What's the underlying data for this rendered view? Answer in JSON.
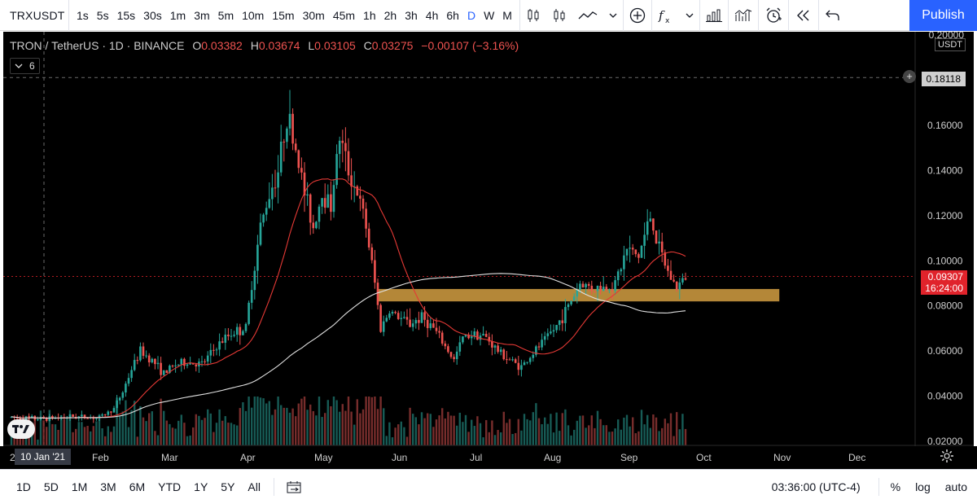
{
  "toolbar": {
    "symbol": "TRXUSDT",
    "intervals": [
      {
        "label": "1s",
        "active": false
      },
      {
        "label": "5s",
        "active": false
      },
      {
        "label": "15s",
        "active": false
      },
      {
        "label": "30s",
        "active": false
      },
      {
        "label": "1m",
        "active": false
      },
      {
        "label": "3m",
        "active": false
      },
      {
        "label": "5m",
        "active": false
      },
      {
        "label": "10m",
        "active": false
      },
      {
        "label": "15m",
        "active": false
      },
      {
        "label": "30m",
        "active": false
      },
      {
        "label": "45m",
        "active": false
      },
      {
        "label": "1h",
        "active": false
      },
      {
        "label": "2h",
        "active": false
      },
      {
        "label": "3h",
        "active": false
      },
      {
        "label": "4h",
        "active": false
      },
      {
        "label": "6h",
        "active": false
      },
      {
        "label": "D",
        "active": true
      },
      {
        "label": "W",
        "active": false
      },
      {
        "label": "M",
        "active": false
      }
    ],
    "icons": [
      "bar-style-icon",
      "candles-icon",
      "line-style-icon",
      "chevron-down-icon",
      "compare-add-icon",
      "indicators-icon",
      "chevron-down-icon",
      "financials-icon",
      "templates-icon",
      "alert-icon",
      "replay-icon",
      "undo-icon"
    ],
    "publish_label": "Publish",
    "accent_color": "#2962ff"
  },
  "legend": {
    "title": "TRON / TetherUS · 1D · BINANCE",
    "open_label": "O",
    "open": "0.03382",
    "high_label": "H",
    "high": "0.03674",
    "low_label": "L",
    "low": "0.03105",
    "close_label": "C",
    "close": "0.03275",
    "change": "−0.00107 (−3.16%)",
    "indicator_count": "6"
  },
  "price_axis": {
    "unit": "USDT",
    "top_label": "0.20000",
    "labels": [
      "0.16000",
      "0.14000",
      "0.12000",
      "0.10000",
      "0.08000",
      "0.06000",
      "0.04000",
      "0.02000"
    ],
    "crosshair_price": "0.18118",
    "last_price": "0.09307",
    "countdown": "16:24:00",
    "last_price_color": "#e0232b"
  },
  "time_axis": {
    "labels": [
      "Feb",
      "Mar",
      "Apr",
      "May",
      "Jun",
      "Jul",
      "Aug",
      "Sep",
      "Oct",
      "Nov",
      "Dec"
    ],
    "crosshair_date": "10 Jan '21",
    "edge_label": "2"
  },
  "bottom_bar": {
    "ranges": [
      "1D",
      "5D",
      "1M",
      "3M",
      "6M",
      "YTD",
      "1Y",
      "5Y",
      "All"
    ],
    "time": "03:36:00 (UTC-4)",
    "percent_label": "%",
    "log_label": "log",
    "auto_label": "auto"
  },
  "chart_data": {
    "type": "candlestick",
    "support_zone": {
      "low": 0.082,
      "high": 0.0875,
      "color": "#c8963e"
    },
    "up_color": "#26a69a",
    "down_color": "#ef5350",
    "ma_fast_color": "#e53935",
    "ma_slow_color": "#e0e0e0",
    "close_path": [
      [
        0,
        0.0305
      ],
      [
        10,
        0.03
      ],
      [
        20,
        0.031
      ],
      [
        30,
        0.0305
      ],
      [
        35,
        0.0345
      ],
      [
        38,
        0.042
      ],
      [
        41,
        0.052
      ],
      [
        44,
        0.06
      ],
      [
        48,
        0.056
      ],
      [
        52,
        0.05
      ],
      [
        56,
        0.054
      ],
      [
        60,
        0.055
      ],
      [
        65,
        0.054
      ],
      [
        70,
        0.062
      ],
      [
        75,
        0.068
      ],
      [
        80,
        0.07
      ],
      [
        82,
        0.09
      ],
      [
        85,
        0.115
      ],
      [
        88,
        0.13
      ],
      [
        91,
        0.14
      ],
      [
        94,
        0.165
      ],
      [
        97,
        0.15
      ],
      [
        100,
        0.13
      ],
      [
        103,
        0.115
      ],
      [
        106,
        0.13
      ],
      [
        109,
        0.125
      ],
      [
        112,
        0.155
      ],
      [
        115,
        0.14
      ],
      [
        118,
        0.13
      ],
      [
        121,
        0.115
      ],
      [
        124,
        0.09
      ],
      [
        126,
        0.07
      ],
      [
        129,
        0.078
      ],
      [
        132,
        0.075
      ],
      [
        136,
        0.072
      ],
      [
        140,
        0.075
      ],
      [
        144,
        0.07
      ],
      [
        148,
        0.062
      ],
      [
        151,
        0.056
      ],
      [
        154,
        0.066
      ],
      [
        158,
        0.068
      ],
      [
        162,
        0.066
      ],
      [
        166,
        0.06
      ],
      [
        170,
        0.056
      ],
      [
        174,
        0.053
      ],
      [
        178,
        0.059
      ],
      [
        182,
        0.065
      ],
      [
        186,
        0.071
      ],
      [
        190,
        0.08
      ],
      [
        194,
        0.09
      ],
      [
        198,
        0.088
      ],
      [
        202,
        0.088
      ],
      [
        206,
        0.09
      ],
      [
        210,
        0.105
      ],
      [
        214,
        0.102
      ],
      [
        218,
        0.12
      ],
      [
        221,
        0.105
      ],
      [
        224,
        0.095
      ],
      [
        227,
        0.088
      ],
      [
        230,
        0.093
      ]
    ],
    "volume_scale": "relative"
  }
}
